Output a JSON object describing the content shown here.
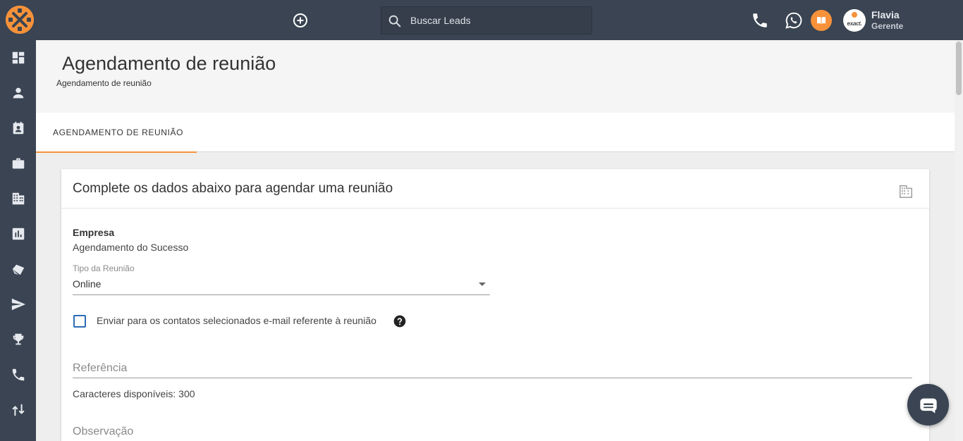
{
  "header": {
    "search_placeholder": "Buscar Leads",
    "user": {
      "name": "Flavia",
      "role": "Gerente",
      "avatar_text": "exact."
    }
  },
  "sidebar": {
    "items": [
      {
        "icon": "dashboard-icon"
      },
      {
        "icon": "person-icon"
      },
      {
        "icon": "contact-calendar-icon"
      },
      {
        "icon": "briefcase-icon"
      },
      {
        "icon": "building-icon"
      },
      {
        "icon": "bar-chart-icon"
      },
      {
        "icon": "tags-icon"
      },
      {
        "icon": "send-icon"
      },
      {
        "icon": "trophy-icon"
      },
      {
        "icon": "phone-icon"
      },
      {
        "icon": "swap-icon"
      }
    ]
  },
  "page": {
    "title": "Agendamento de reunião",
    "breadcrumb": "Agendamento de reunião",
    "tab_label": "AGENDAMENTO DE REUNIÃO"
  },
  "form": {
    "card_title": "Complete os dados abaixo para agendar uma reunião",
    "empresa_label": "Empresa",
    "empresa_value": "Agendamento do Sucesso",
    "tipo_label": "Tipo da Reunião",
    "tipo_value": "Online",
    "email_checkbox_label": "Enviar para os contatos selecionados e-mail referente à reunião",
    "email_checkbox_checked": false,
    "referencia_placeholder": "Referência",
    "chars_available": "Caracteres disponíveis: 300",
    "observacao_placeholder": "Observação"
  },
  "colors": {
    "topbar": "#3a4452",
    "accent": "#f7923a",
    "checkbox_border": "#2d6cb5"
  }
}
